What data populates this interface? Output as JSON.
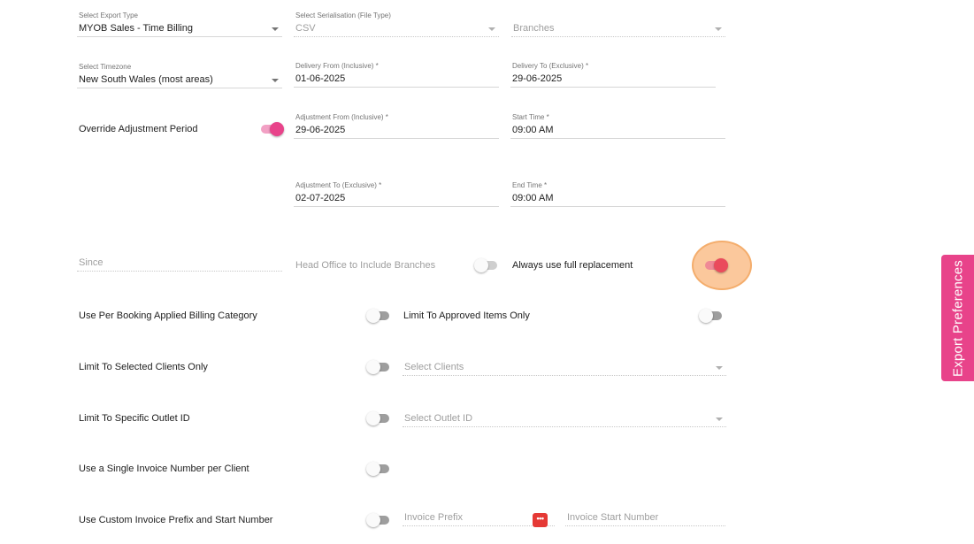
{
  "export_type": {
    "label": "Select Export Type",
    "value": "MYOB Sales - Time Billing"
  },
  "serialisation": {
    "label": "Select Serialisation (File Type)",
    "value": "CSV"
  },
  "branches": {
    "placeholder": "Branches"
  },
  "timezone": {
    "label": "Select Timezone",
    "value": "New South Wales (most areas)"
  },
  "delivery_from": {
    "label": "Delivery From (Inclusive) *",
    "value": "01-06-2025"
  },
  "delivery_to": {
    "label": "Delivery To (Exclusive) *",
    "value": "29-06-2025"
  },
  "override_adjustment": {
    "label": "Override Adjustment Period",
    "on": true
  },
  "adjustment_from": {
    "label": "Adjustment From (Inclusive) *",
    "value": "29-06-2025"
  },
  "start_time": {
    "label": "Start Time *",
    "value": "09:00  AM"
  },
  "adjustment_to": {
    "label": "Adjustment To (Exclusive) *",
    "value": "02-07-2025"
  },
  "end_time": {
    "label": "End Time *",
    "value": "09:00  AM"
  },
  "since": {
    "placeholder": "Since"
  },
  "head_office": {
    "label": "Head Office to Include Branches",
    "on": false
  },
  "full_replacement": {
    "label": "Always use full replacement",
    "on": true
  },
  "per_booking_billing": {
    "label": "Use Per Booking Applied Billing Category",
    "on": false
  },
  "approved_items": {
    "label": "Limit To Approved Items Only",
    "on": false
  },
  "selected_clients": {
    "label": "Limit To Selected Clients Only",
    "on": false,
    "select_placeholder": "Select Clients"
  },
  "specific_outlet": {
    "label": "Limit To Specific Outlet ID",
    "on": false,
    "select_placeholder": "Select Outlet ID"
  },
  "single_invoice": {
    "label": "Use a Single Invoice Number per Client",
    "on": false
  },
  "custom_invoice": {
    "label": "Use Custom Invoice Prefix and Start Number",
    "on": false,
    "prefix_placeholder": "Invoice Prefix",
    "start_placeholder": "Invoice Start Number",
    "dots": "•••"
  },
  "side_tab": {
    "label": "Export Preferences"
  },
  "colors": {
    "accent": "#e8438a",
    "highlight": "#fbc89c",
    "danger": "#e53935"
  },
  "icons": [
    "dropdown-caret-icon",
    "more-dots-icon"
  ]
}
